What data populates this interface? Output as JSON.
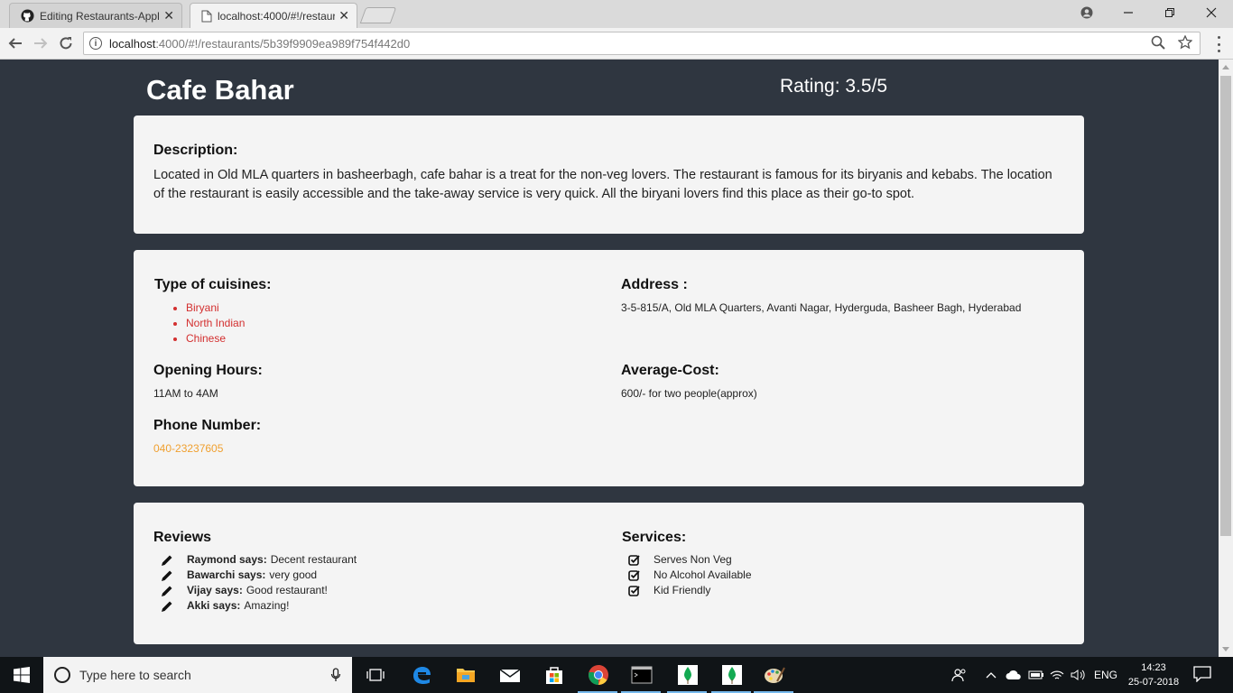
{
  "browser": {
    "tabs": [
      {
        "title": "Editing Restaurants-Appli",
        "close": "✕"
      },
      {
        "title": "localhost:4000/#!/restaur",
        "close": "✕"
      }
    ],
    "url_host": "localhost",
    "url_path": ":4000/#!/restaurants/5b39f9909ea989f754f442d0"
  },
  "restaurant": {
    "name": "Cafe Bahar",
    "rating": "Rating: 3.5/5",
    "description_heading": "Description:",
    "description": "Located in Old MLA quarters in basheerbagh, cafe bahar is a treat for the non-veg lovers. The restaurant is famous for its biryanis and kebabs. The location of the restaurant is easily accessible and the take-away service is very quick. All the biryani lovers find this place as their go-to spot.",
    "cuisines_heading": "Type of cuisines:",
    "cuisines": [
      "Biryani",
      "North Indian",
      "Chinese"
    ],
    "address_heading": "Address :",
    "address": "3-5-815/A, Old MLA Quarters, Avanti Nagar, Hyderguda, Basheer Bagh, Hyderabad",
    "hours_heading": "Opening Hours:",
    "hours": "11AM to 4AM",
    "cost_heading": "Average-Cost:",
    "cost": "600/- for two people(approx)",
    "phone_heading": "Phone Number:",
    "phone": "040-23237605",
    "reviews_heading": "Reviews",
    "reviews": [
      {
        "user": "Raymond says:",
        "text": "Decent restaurant"
      },
      {
        "user": "Bawarchi says:",
        "text": "very good"
      },
      {
        "user": "Vijay says:",
        "text": "Good restaurant!"
      },
      {
        "user": "Akki says:",
        "text": "Amazing!"
      }
    ],
    "services_heading": "Services:",
    "services": [
      "Serves Non Veg",
      "No Alcohol Available",
      "Kid Friendly"
    ]
  },
  "taskbar": {
    "search_placeholder": "Type here to search",
    "language": "ENG",
    "time": "14:23",
    "date": "25-07-2018"
  },
  "colors": {
    "page_bg": "#2f3640",
    "card_bg": "#f4f4f4",
    "cuisine": "#d32f2f",
    "phone": "#f0a030"
  },
  "icons": [
    "github-icon",
    "page-icon",
    "back-icon",
    "forward-icon",
    "reload-icon",
    "info-icon",
    "zoom-icon",
    "star-icon",
    "menu-icon",
    "pencil-icon",
    "checkbox-icon",
    "windows-icon",
    "search-icon",
    "mic-icon",
    "task-view-icon",
    "edge-icon",
    "explorer-icon",
    "mail-icon",
    "store-icon",
    "chrome-icon",
    "terminal-icon",
    "mongodb-icon",
    "paint-icon",
    "people-icon",
    "network-icon",
    "battery-icon",
    "wifi-icon",
    "volume-icon",
    "notification-icon"
  ]
}
